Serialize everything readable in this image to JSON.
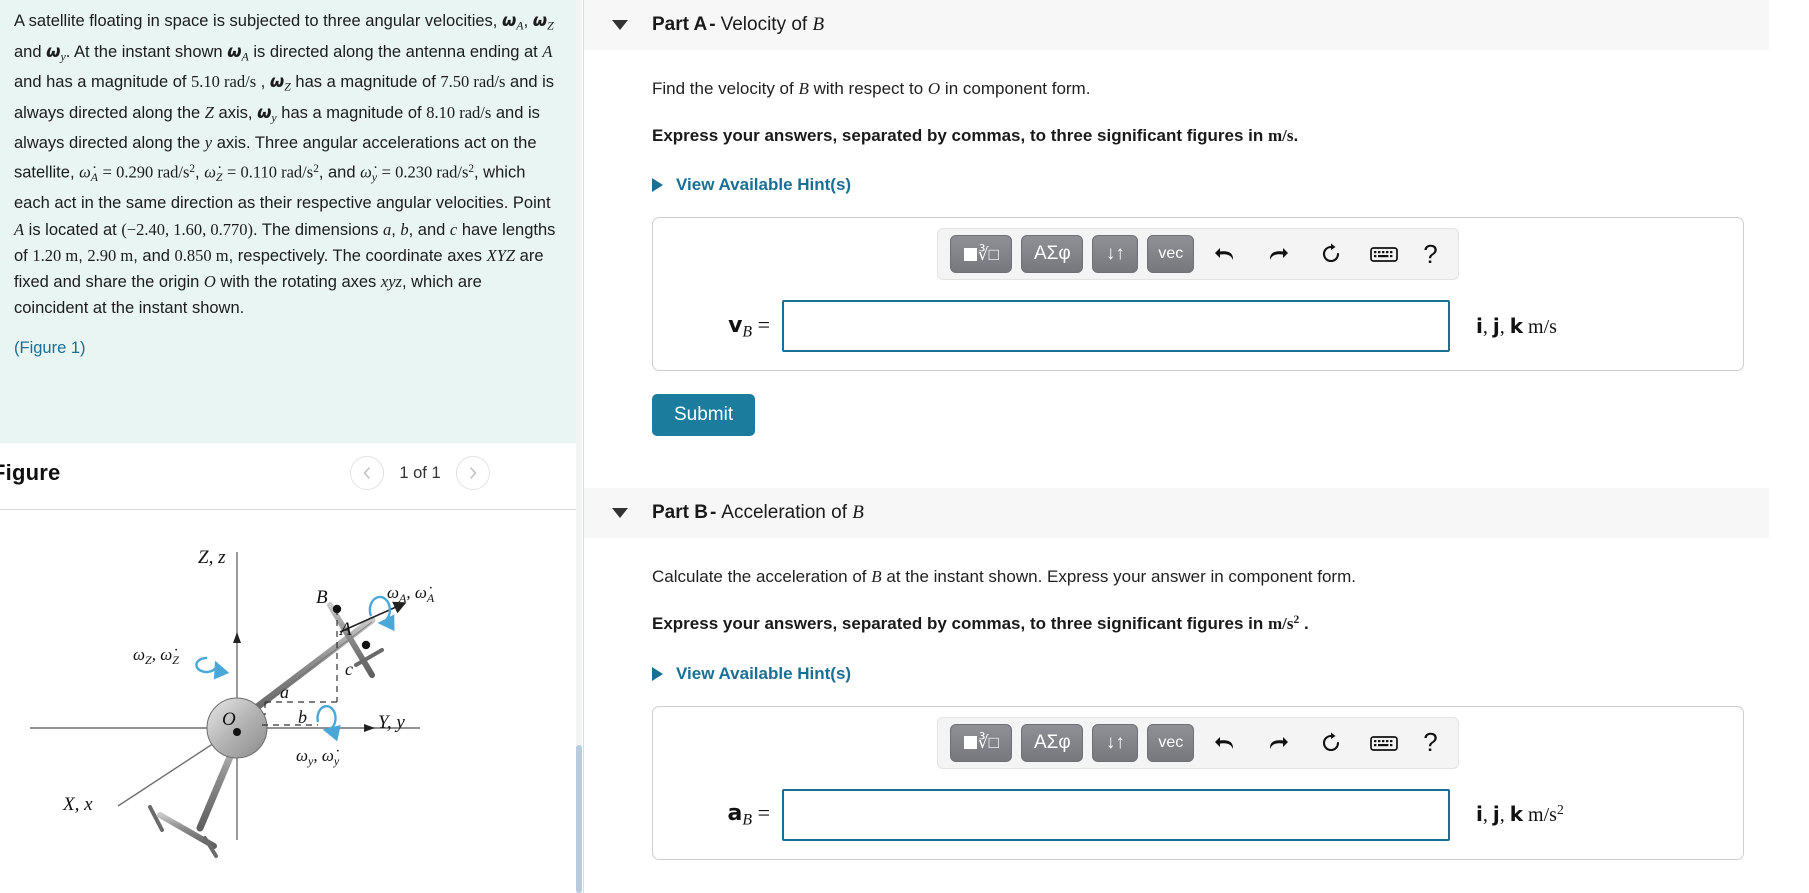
{
  "problem": {
    "paragraph_html": "A satellite floating in space is subjected to three angular velocities, <b class=\"bsym\">ω</b><span class=\"sub\">A</span>, <b class=\"bsym\">ω</b><span class=\"sub\">Z</span> and <b class=\"bsym\">ω</b><span class=\"sub\">y</span>. At the instant shown <b class=\"bsym\">ω</b><span class=\"sub\">A</span> is directed along the antenna ending at <span class=\"mi\">A</span> and has a magnitude of <span class=\"mu\">5.10 rad/s</span> , <b class=\"bsym\">ω</b><span class=\"sub\">Z</span> has a magnitude of <span class=\"mu\">7.50 rad/s</span> and is always directed along the <span class=\"mi\">Z</span> axis, <b class=\"bsym\">ω</b><span class=\"sub\">y</span> has a magnitude of <span class=\"mu\">8.10 rad/s</span> and is always directed along the <span class=\"mi\">y</span> axis. Three angular accelerations act on the satellite, <span class=\"mi\">ω̇</span><span class=\"sub\">A</span> <span class=\"mu\">= 0.290 rad/s</span><span class=\"sup\">2</span>, <span class=\"mi\">ω̇</span><span class=\"sub\">Z</span> <span class=\"mu\">= 0.110 rad/s</span><span class=\"sup\">2</span>, and <span class=\"mi\">ω̇</span><span class=\"sub\">y</span> <span class=\"mu\">= 0.230 rad/s</span><span class=\"sup\">2</span>, which each act in the same direction as their respective angular velocities. Point <span class=\"mi\">A</span> is located at <span class=\"mu\">(−2.40, 1.60, 0.770)</span>. The dimensions <span class=\"mi\">a</span>, <span class=\"mi\">b</span>, and <span class=\"mi\">c</span> have lengths of <span class=\"mu\">1.20 m</span>, <span class=\"mu\">2.90 m</span>, and <span class=\"mu\">0.850 m</span>, respectively. The coordinate axes <span class=\"mi\">XYZ</span> are fixed and share the origin <span class=\"mi\">O</span> with the rotating axes <span class=\"mi\">xyz</span>, which are coincident at the instant shown.",
    "figure_link": "(Figure 1)",
    "values": {
      "omega_A": "5.10 rad/s",
      "omega_Z": "7.50 rad/s",
      "omega_y": "8.10 rad/s",
      "alpha_A": "0.290 rad/s²",
      "alpha_Z": "0.110 rad/s²",
      "alpha_y": "0.230 rad/s²",
      "point_A": "(−2.40, 1.60, 0.770)",
      "a": "1.20 m",
      "b": "2.90 m",
      "c": "0.850 m"
    }
  },
  "figure": {
    "title": "Figure",
    "counter": "1 of 1",
    "prev_icon": "chevron-left-icon",
    "next_icon": "chevron-right-icon",
    "labels": {
      "axis_z": "Z, z",
      "axis_y": "Y, y",
      "axis_x": "X, x",
      "origin": "O",
      "point_B": "B",
      "point_A": "A",
      "dim_a": "a",
      "dim_b": "b",
      "dim_c": "c",
      "omega_A": "ωₐ, ω̇ₐ",
      "omega_Z": "ω_Z, ω̇_Z",
      "omega_y": "ω_y, ω̇_y"
    }
  },
  "toolbar": {
    "template_label": "template-radical",
    "greek_label": "ΑΣφ",
    "updown_label": "↓↑",
    "vec_label": "vec",
    "undo_label": "undo-icon",
    "redo_label": "redo-icon",
    "reset_label": "reset-icon",
    "keyboard_label": "keyboard-icon",
    "help_label": "?"
  },
  "parts": [
    {
      "id": "A",
      "label": "Part A",
      "separator": "-",
      "subtitle": "Velocity of B",
      "prompt_html": "Find the velocity of <span class=\"mi\">B</span> with respect to <span class=\"mi\">O</span> in component form.",
      "express_html": "Express your answers, separated by commas, to three significant figures in <span class=\"mu\">m/s</span>.",
      "hints_label": "View Available Hint(s)",
      "answer_label_html": "<b>v</b><span class=\"sub\">B</span> =",
      "answer_value": "",
      "answer_placeholder": "",
      "units_html": "<b>i</b>, <b>j</b>, <b>k</b> m/s",
      "submit_label": "Submit",
      "has_submit": true
    },
    {
      "id": "B",
      "label": "Part B",
      "separator": "-",
      "subtitle": "Acceleration of B",
      "prompt_html": "Calculate the acceleration of <span class=\"mi\">B</span> at the instant shown. Express your answer in component form.",
      "express_html": "Express your answers, separated by commas, to three significant figures in <span class=\"mu\">m/s<span class=\"sup\">2</span></span> .",
      "hints_label": "View Available Hint(s)",
      "answer_label_html": "<b>a</b><span class=\"sub\">B</span> =",
      "answer_value": "",
      "answer_placeholder": "",
      "units_html": "<b>i</b>, <b>j</b>, <b>k</b> m/s<span class=\"sup\">2</span>",
      "submit_label": "Submit",
      "has_submit": false
    }
  ],
  "colors": {
    "problem_bg": "#e8f5f2",
    "accent_teal": "#1a6f94",
    "submit_bg": "#1b7c9e",
    "header_bg": "#f7f7f7",
    "diagram_arc": "#4aa8d8"
  }
}
